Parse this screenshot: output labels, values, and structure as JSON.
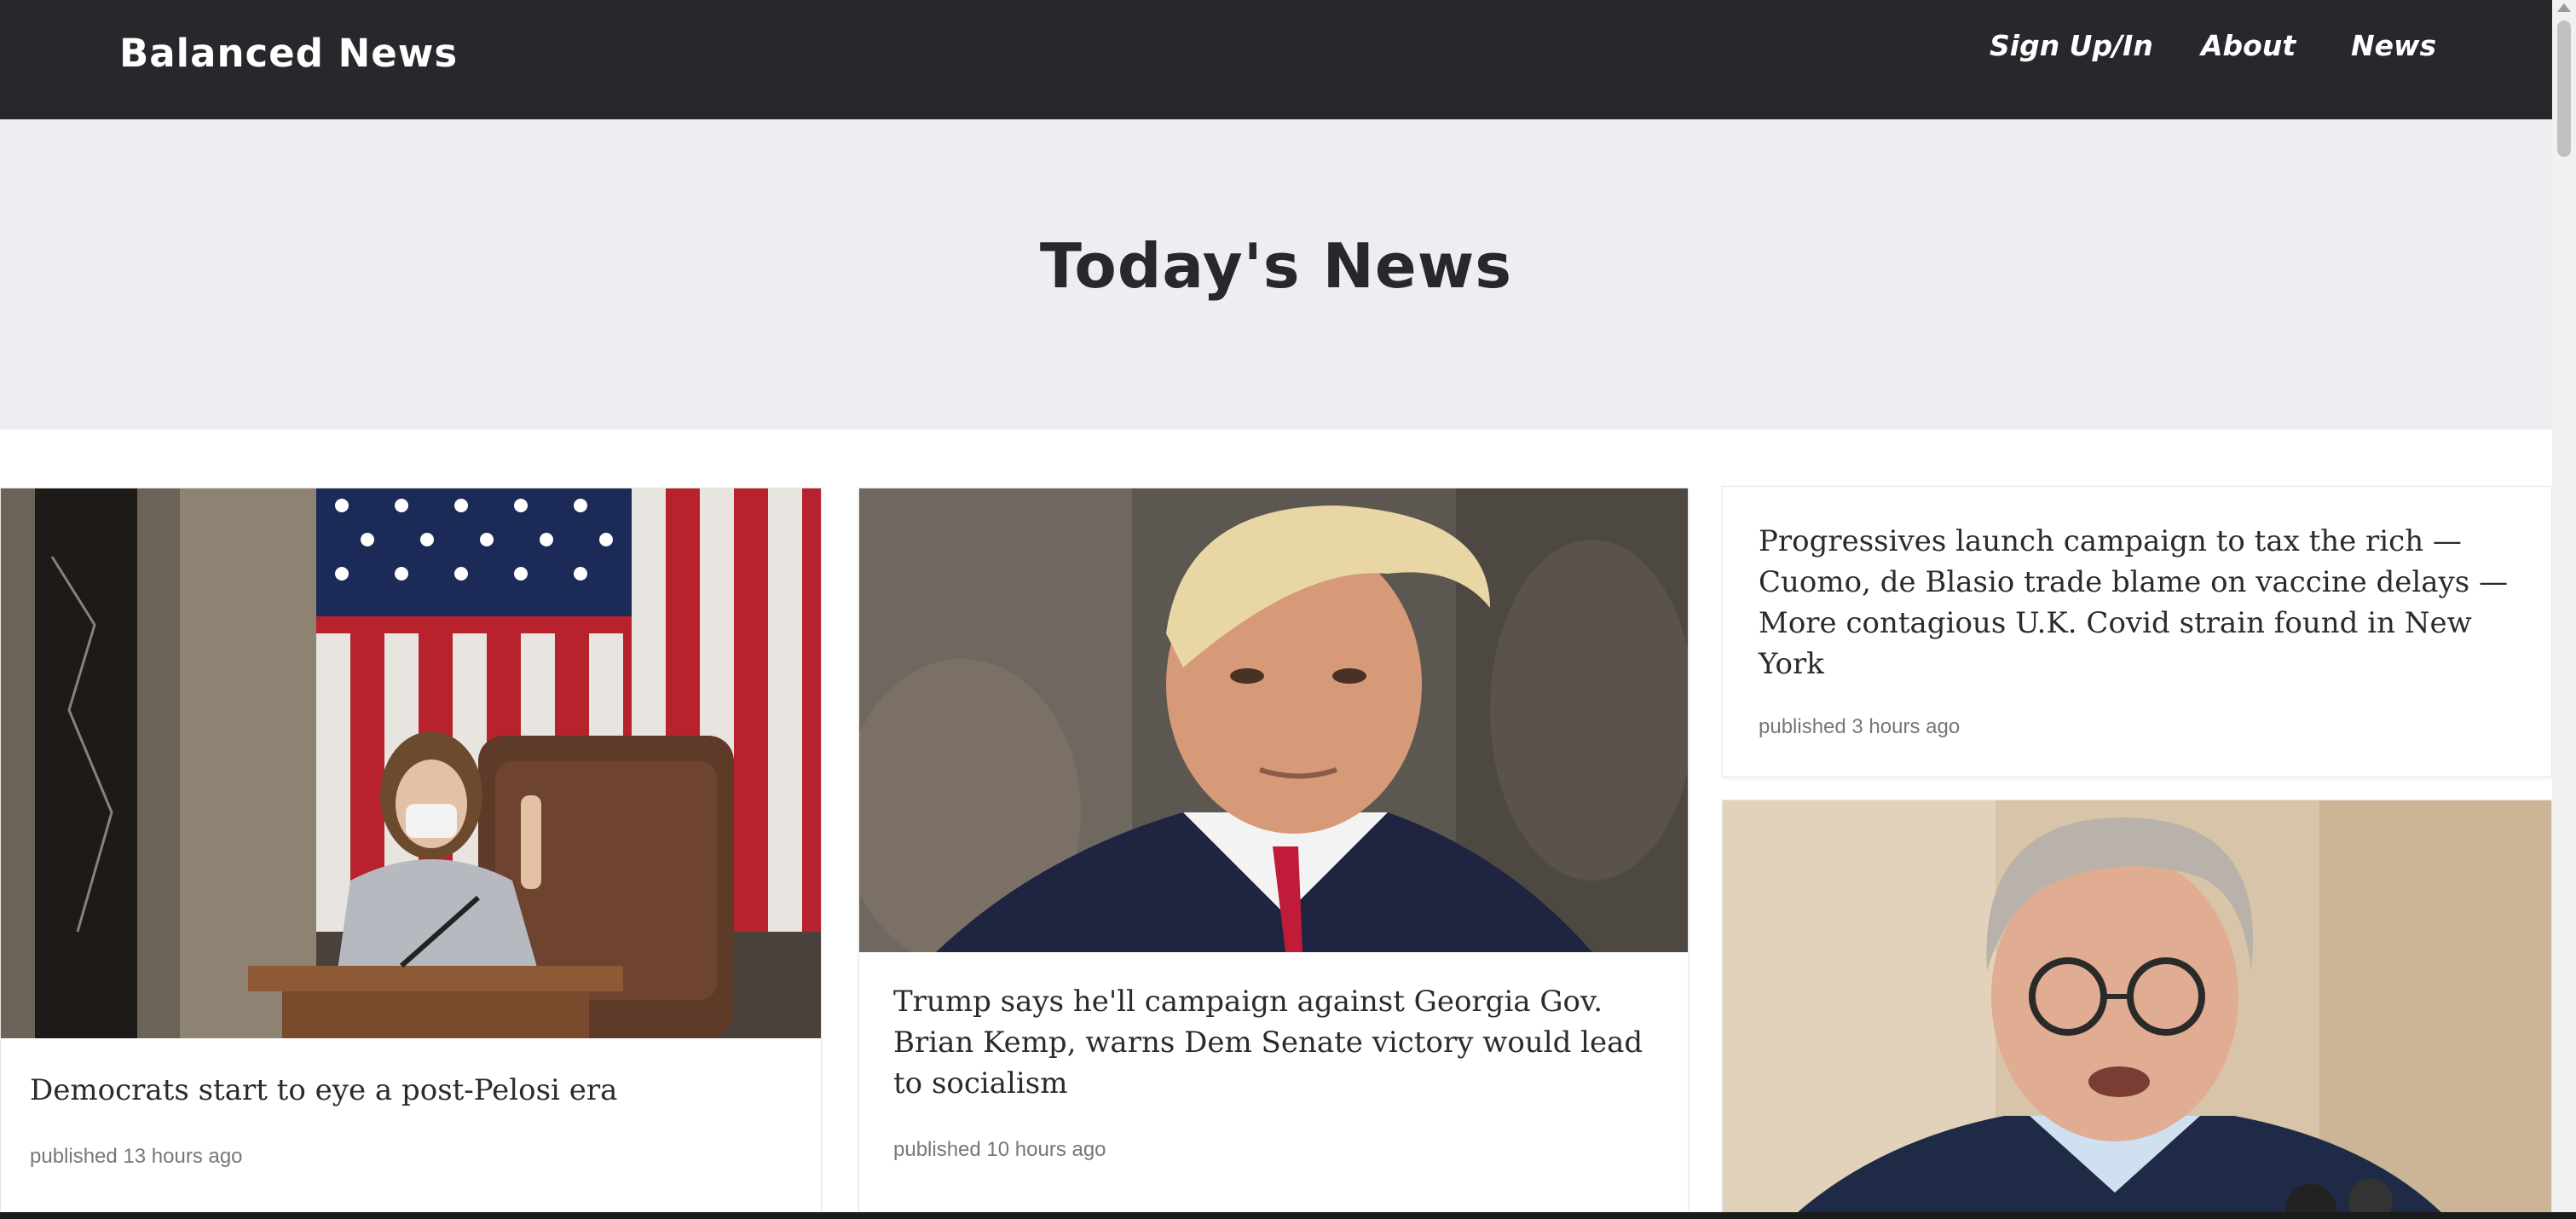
{
  "header": {
    "brand": "Balanced News",
    "nav": [
      {
        "label": "Sign Up/In"
      },
      {
        "label": "About"
      },
      {
        "label": "News"
      }
    ]
  },
  "hero": {
    "title": "Today's News"
  },
  "cards": [
    {
      "title": "Democrats start to eye a post-Pelosi era",
      "published": "published 13 hours ago"
    },
    {
      "title": "Trump says he'll campaign against Georgia Gov. Brian Kemp, warns Dem Senate victory would lead to socialism",
      "published": "published 10 hours ago"
    },
    {
      "title": "Progressives launch campaign to tax the rich — Cuomo, de Blasio trade blame on vaccine delays — More contagious U.K. Covid strain found in New York",
      "published": "published 3 hours ago"
    }
  ],
  "colors": {
    "navbar": "#26282c",
    "hero_bg": "#efedf2",
    "text": "#2b2b2b"
  }
}
